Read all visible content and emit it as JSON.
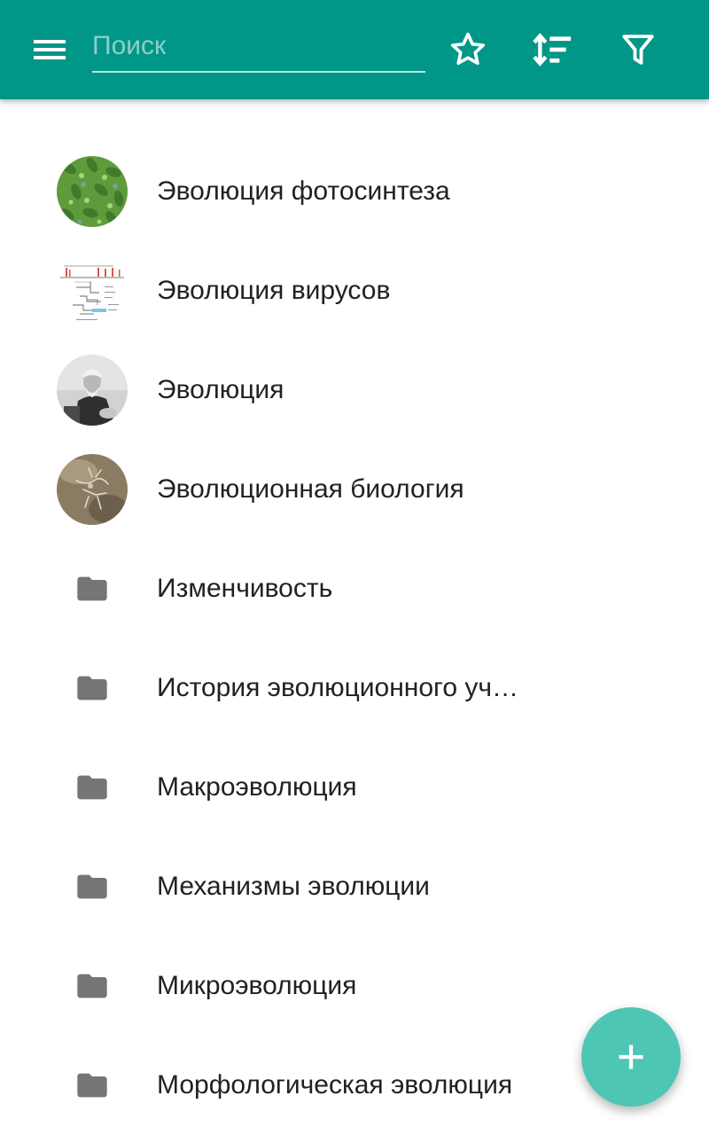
{
  "colors": {
    "app_bar": "#009688",
    "fab": "#4ec6b6",
    "folder_icon": "#757575",
    "text": "#212121"
  },
  "toolbar": {
    "menu_icon": "hamburger-menu-icon",
    "search_placeholder": "Поиск",
    "search_value": "",
    "favorites_icon": "star-outline-icon",
    "sort_icon": "sort-icon",
    "filter_icon": "filter-icon"
  },
  "items": [
    {
      "label": "Эволюция фотосинтеза",
      "icon": "photosynthesis-thumbnail"
    },
    {
      "label": "Эволюция вирусов",
      "icon": "virus-diagram-thumbnail"
    },
    {
      "label": "Эволюция",
      "icon": "darwin-portrait-thumbnail"
    },
    {
      "label": "Эволюционная биология",
      "icon": "fossil-thumbnail"
    },
    {
      "label": "Изменчивость",
      "icon": "folder-icon"
    },
    {
      "label": "История эволюционного уч…",
      "icon": "folder-icon"
    },
    {
      "label": "Макроэволюция",
      "icon": "folder-icon"
    },
    {
      "label": "Механизмы эволюции",
      "icon": "folder-icon"
    },
    {
      "label": "Микроэволюция",
      "icon": "folder-icon"
    },
    {
      "label": "Морфологическая эволюция",
      "icon": "folder-icon"
    }
  ],
  "fab": {
    "icon": "plus-icon"
  }
}
